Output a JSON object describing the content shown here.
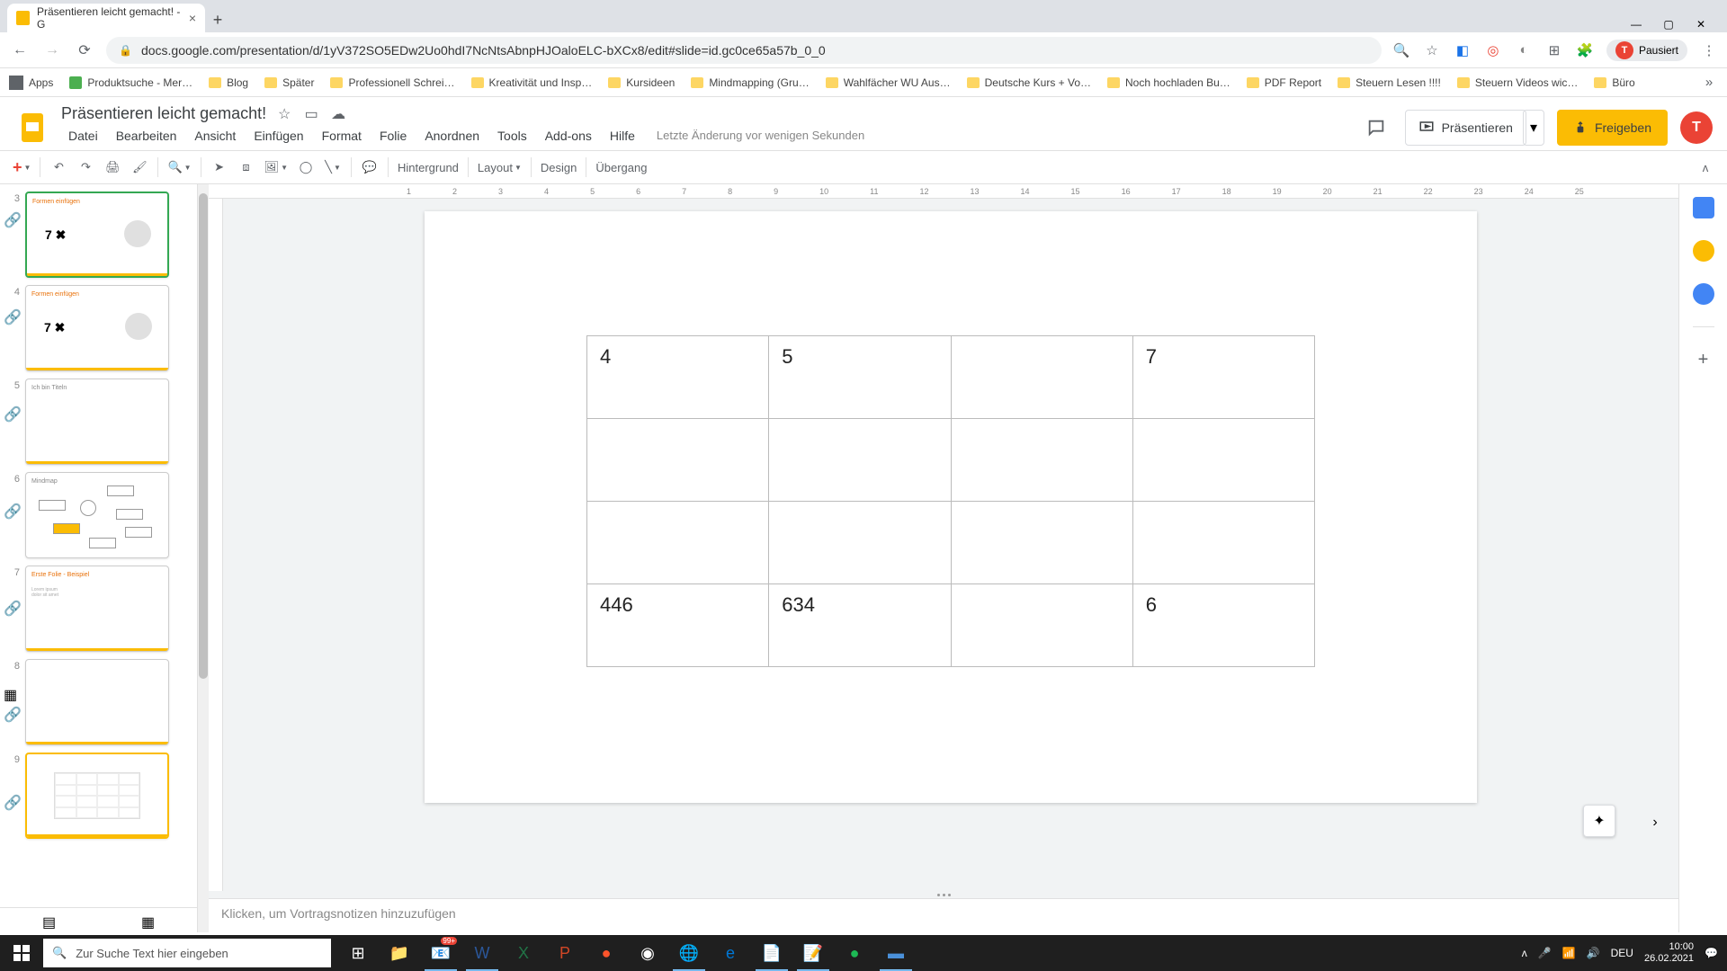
{
  "browser": {
    "tab_title": "Präsentieren leicht gemacht! - G",
    "url": "docs.google.com/presentation/d/1yV372SO5EDw2Uo0hdI7NcNtsAbnpHJOaloELC-bXCx8/edit#slide=id.gc0ce65a57b_0_0",
    "profile_status": "Pausiert",
    "profile_letter": "T"
  },
  "bookmarks": [
    "Apps",
    "Produktsuche - Mer…",
    "Blog",
    "Später",
    "Professionell Schrei…",
    "Kreativität und Insp…",
    "Kursideen",
    "Mindmapping (Gru…",
    "Wahlfächer WU Aus…",
    "Deutsche Kurs + Vo…",
    "Noch hochladen Bu…",
    "PDF Report",
    "Steuern Lesen !!!!",
    "Steuern Videos wic…",
    "Büro"
  ],
  "doc": {
    "title": "Präsentieren leicht gemacht!",
    "menus": [
      "Datei",
      "Bearbeiten",
      "Ansicht",
      "Einfügen",
      "Format",
      "Folie",
      "Anordnen",
      "Tools",
      "Add-ons",
      "Hilfe"
    ],
    "last_edit": "Letzte Änderung vor wenigen Sekunden",
    "present": "Präsentieren",
    "share": "Freigeben"
  },
  "toolbar": {
    "background": "Hintergrund",
    "layout": "Layout",
    "design": "Design",
    "transition": "Übergang"
  },
  "ruler_h": [
    "1",
    "2",
    "3",
    "4",
    "5",
    "6",
    "7",
    "8",
    "9",
    "10",
    "11",
    "12",
    "13",
    "14",
    "15",
    "16",
    "17",
    "18",
    "19",
    "20",
    "21",
    "22",
    "23",
    "24",
    "25"
  ],
  "slide_table": [
    [
      "4",
      "5",
      "",
      "7"
    ],
    [
      "",
      "",
      "",
      ""
    ],
    [
      "",
      "",
      "",
      ""
    ],
    [
      "446",
      "634",
      "",
      "6"
    ]
  ],
  "notes_placeholder": "Klicken, um Vortragsnotizen hinzuzufügen",
  "thumbs": [
    {
      "n": "3",
      "caption": "Formen einfügen",
      "big": "7 ✖"
    },
    {
      "n": "4",
      "caption": "Formen einfügen",
      "big": "7 ✖"
    },
    {
      "n": "5",
      "caption": "Ich bin Titeln"
    },
    {
      "n": "6",
      "caption": "Mindmap"
    },
    {
      "n": "7",
      "caption": "Erste Folie - Beispiel"
    },
    {
      "n": "8",
      "caption": ""
    },
    {
      "n": "9",
      "caption": ""
    }
  ],
  "taskbar": {
    "search_placeholder": "Zur Suche Text hier eingeben",
    "lang": "DEU",
    "time": "10:00",
    "date": "26.02.2021",
    "notifications": "99+"
  }
}
